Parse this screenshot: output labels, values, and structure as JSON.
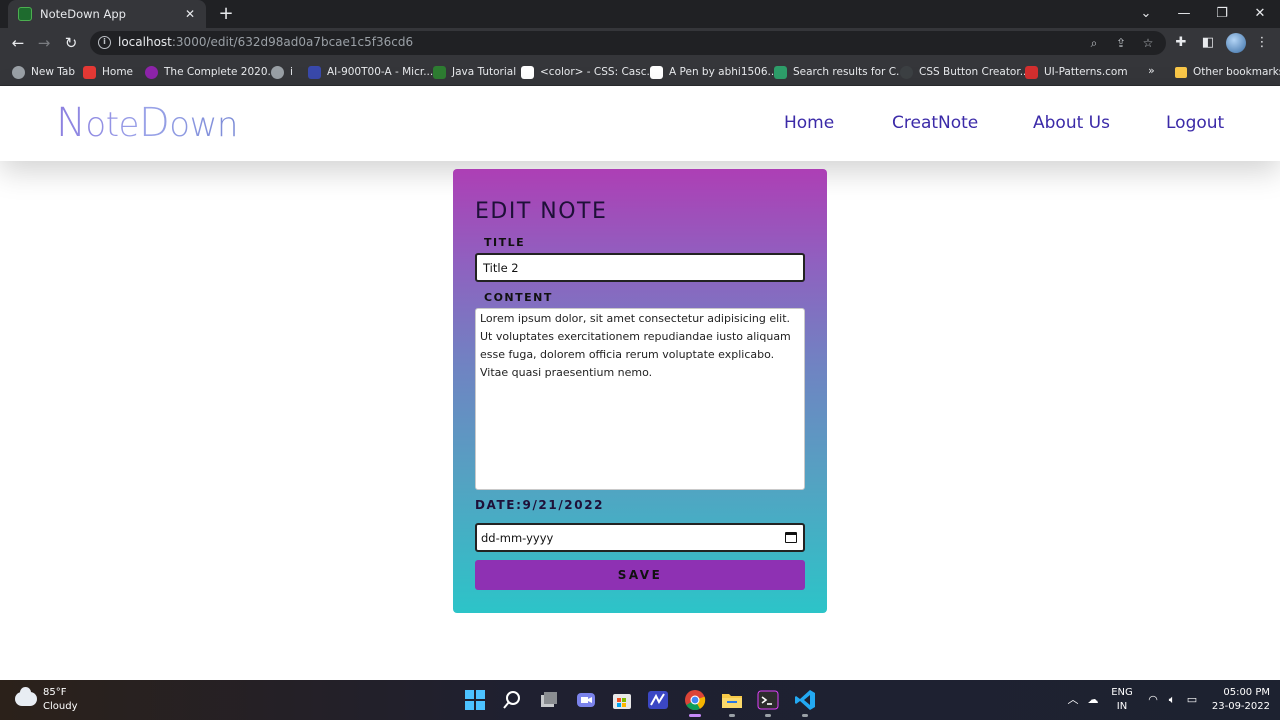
{
  "browser": {
    "tab_title": "NoteDown App",
    "url_host": "localhost",
    "url_rest": ":3000/edit/632d98ad0a7bcae1c5f36cd6",
    "bookmarks": [
      {
        "label": "New Tab",
        "color": "#9aa0a6"
      },
      {
        "label": "Home",
        "color": "#e53935"
      },
      {
        "label": "The Complete 2020...",
        "color": "#8e24aa"
      },
      {
        "label": "i",
        "color": "#9aa0a6"
      },
      {
        "label": "AI-900T00-A - Micr...",
        "color": "#3949ab"
      },
      {
        "label": "Java Tutorial",
        "color": "#2e7d32"
      },
      {
        "label": "<color> - CSS: Casc...",
        "color": "#ffffff"
      },
      {
        "label": "A Pen by abhi1506...",
        "color": "#ffffff"
      },
      {
        "label": "Search results for C...",
        "color": "#2e9e6a"
      },
      {
        "label": "CSS Button Creator...",
        "color": "#3c4043"
      },
      {
        "label": "UI-Patterns.com",
        "color": "#d32f2f"
      }
    ],
    "bookmarks_more": "»",
    "other_bookmarks": "Other bookmarks"
  },
  "app": {
    "logo_cap_n": "N",
    "logo_mid": "ote",
    "logo_cap_d": "D",
    "logo_end": "own",
    "nav": [
      "Home",
      "CreatNote",
      "About Us",
      "Logout"
    ]
  },
  "form": {
    "heading": "EDIT NOTE",
    "title_label": "TITLE",
    "title_value": "Title 2",
    "content_label": "CONTENT",
    "content_value": " Lorem ipsum dolor, sit amet consectetur adipisicing elit. Ut voluptates exercitationem repudiandae iusto aliquam esse fuga, dolorem officia rerum voluptate explicabo. Vitae quasi praesentium nemo.",
    "date_label": "DATE:9/21/2022",
    "date_placeholder": "dd-mm-yyyy",
    "save_label": "SAVE"
  },
  "taskbar": {
    "temperature": "85°F",
    "weather": "Cloudy",
    "lang_top": "ENG",
    "lang_bottom": "IN",
    "time": "05:00 PM",
    "date": "23-09-2022"
  },
  "colors": {
    "nav_link": "#3b2aa8",
    "save_button": "#8e31b3",
    "card_top": "#ad3fb5",
    "card_bottom": "#2cc4c8"
  }
}
